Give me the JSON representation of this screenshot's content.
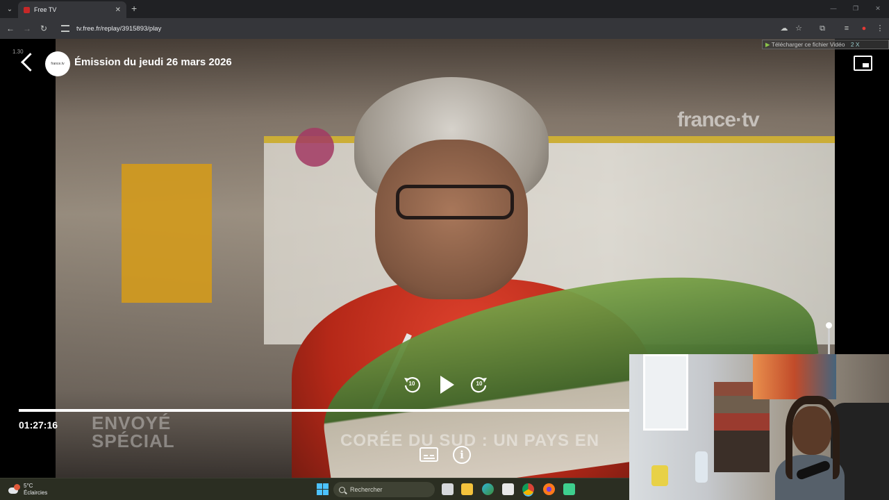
{
  "browser": {
    "tab_title": "Free TV",
    "url": "tv.free.fr/replay/3915893/play",
    "icons": [
      "tab-search-icon",
      "new-tab-icon",
      "back-icon",
      "forward-icon",
      "reload-icon",
      "site-info-icon",
      "cast-icon",
      "bookmark-star-icon",
      "extensions-icon",
      "profile-icon",
      "menu-icon"
    ]
  },
  "player": {
    "frame_counter": "1.30",
    "episode_title": "Émission du jeudi 26 mars 2026",
    "channel_logo_text": "france.tv",
    "watermark": "france·tv",
    "show_logo_line1": "ENVOYÉ",
    "show_logo_line2": "SPÉCIAL",
    "caption": "CORÉE DU SUD : UN PAYS EN",
    "download_button": "Télécharger ce fichier Vidéo",
    "download_extra": "2 X",
    "rewind_seconds": "10",
    "forward_seconds": "10",
    "current_time": "01:27:16",
    "progress_fraction": 0.785,
    "volume_level": 1.0
  },
  "taskbar": {
    "temperature": "5°C",
    "weather_desc": "Éclaircies",
    "search_placeholder": "Rechercher"
  },
  "colors": {
    "taskbar": "#2b2e22",
    "browser_toolbar": "#35363a",
    "accent_windows": "#4cc2ff"
  }
}
